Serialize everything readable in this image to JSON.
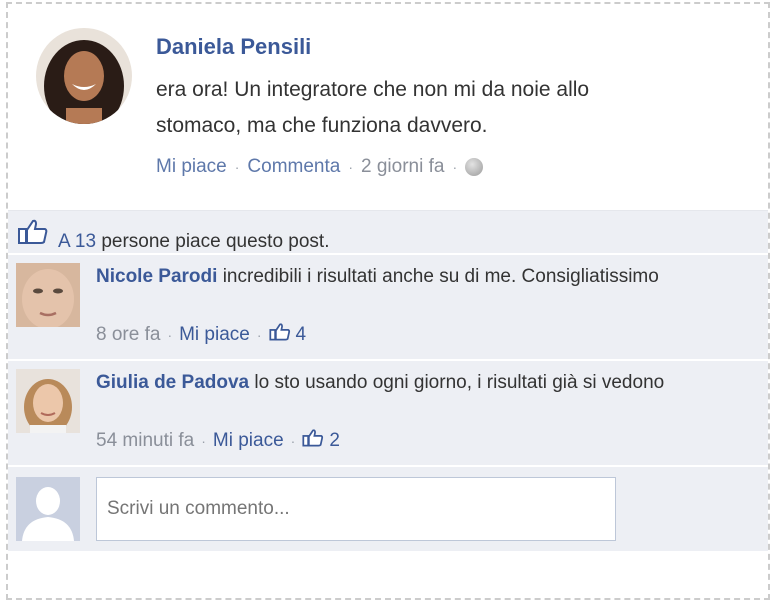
{
  "post": {
    "author": "Daniela Pensili",
    "message": "era ora! Un integratore che non mi da noie allo stomaco, ma che funziona davvero.",
    "like_label": "Mi piace",
    "comment_label": "Commenta",
    "time": "2 giorni fa",
    "privacy_icon": "globe-icon"
  },
  "likes": {
    "prefix": "A",
    "count": "13",
    "suffix": "persone piace questo post."
  },
  "comments": [
    {
      "name": "Nicole Parodi",
      "text": "incredibili i risultati anche su di me. Consigliatissimo",
      "time": "8 ore fa",
      "like_label": "Mi piace",
      "likes": "4"
    },
    {
      "name": "Giulia de Padova",
      "text": "lo sto usando ogni giorno, i risultati già si vedono",
      "time": "54 minuti fa",
      "like_label": "Mi piace",
      "likes": "2"
    }
  ],
  "composer": {
    "placeholder": "Scrivi un commento..."
  },
  "colors": {
    "link": "#3b5998",
    "background": "#edeff4"
  }
}
